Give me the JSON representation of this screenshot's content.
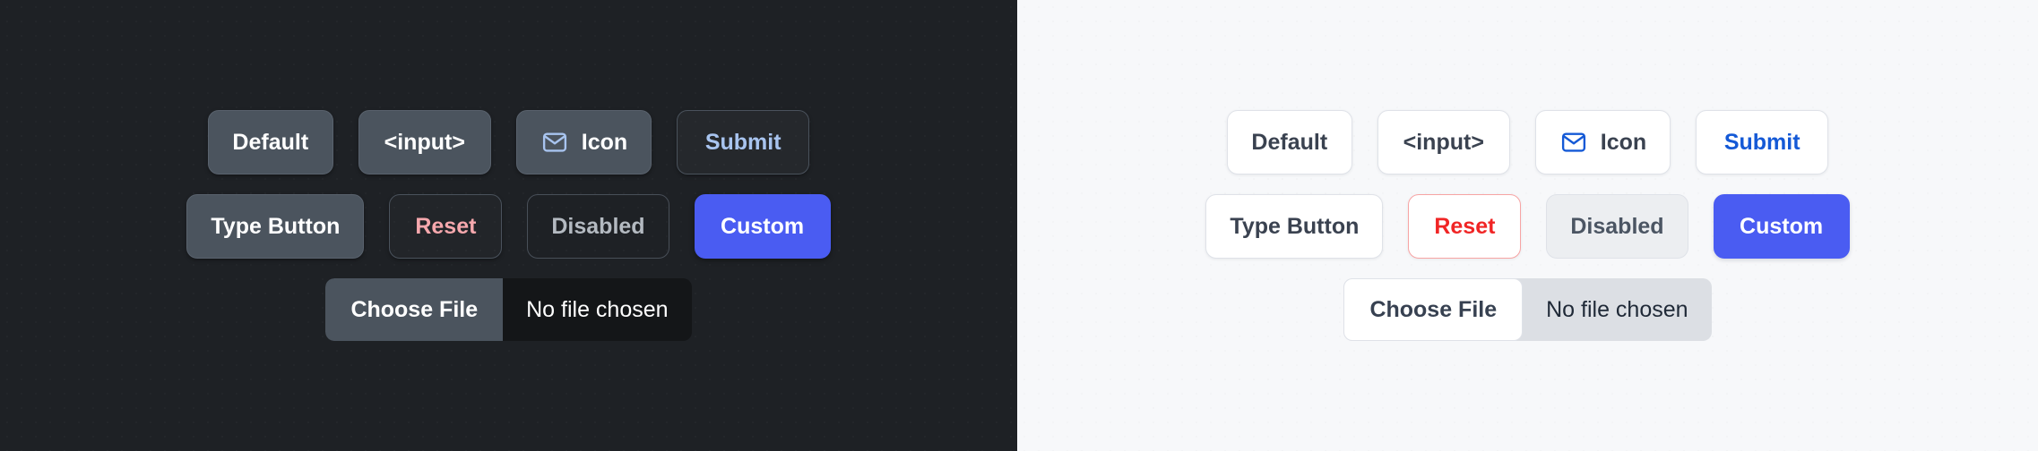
{
  "themes": {
    "dark": {
      "name": "dark",
      "background_color": "#1e2125",
      "row1": [
        {
          "label": "Default",
          "name": "default-button"
        },
        {
          "label": "<input>",
          "name": "input-button"
        },
        {
          "label": "Icon",
          "name": "icon-button",
          "icon": "envelope-icon",
          "icon_color": "#a8c4ef"
        },
        {
          "label": "Submit",
          "name": "submit-button",
          "text_color": "#a8c4ef"
        }
      ],
      "row2": [
        {
          "label": "Type Button",
          "name": "type-button"
        },
        {
          "label": "Reset",
          "name": "reset-button",
          "text_color": "#f6a8ad"
        },
        {
          "label": "Disabled",
          "name": "disabled-button",
          "disabled": true
        },
        {
          "label": "Custom",
          "name": "custom-button",
          "background_color": "#4a5cf2"
        }
      ],
      "file_input": {
        "button_label": "Choose File",
        "status_text": "No file chosen"
      }
    },
    "light": {
      "name": "light",
      "background_color": "#f7f8fa",
      "row1": [
        {
          "label": "Default",
          "name": "default-button"
        },
        {
          "label": "<input>",
          "name": "input-button"
        },
        {
          "label": "Icon",
          "name": "icon-button",
          "icon": "envelope-icon",
          "icon_color": "#1459d6"
        },
        {
          "label": "Submit",
          "name": "submit-button",
          "text_color": "#1459d6"
        }
      ],
      "row2": [
        {
          "label": "Type Button",
          "name": "type-button"
        },
        {
          "label": "Reset",
          "name": "reset-button",
          "text_color": "#f02525",
          "border_color": "#f7a4a4"
        },
        {
          "label": "Disabled",
          "name": "disabled-button",
          "disabled": true
        },
        {
          "label": "Custom",
          "name": "custom-button",
          "background_color": "#4a5cf2"
        }
      ],
      "file_input": {
        "button_label": "Choose File",
        "status_text": "No file chosen"
      }
    }
  }
}
